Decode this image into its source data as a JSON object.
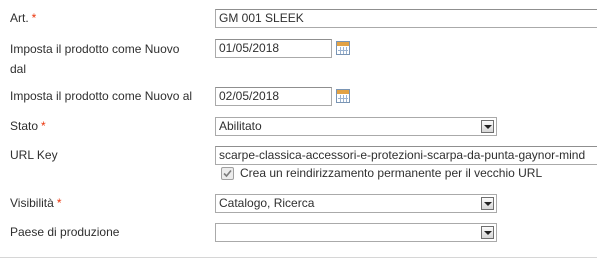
{
  "fields": {
    "art": {
      "label": "Art.",
      "required_mark": "*",
      "value": "GM 001 SLEEK"
    },
    "new_from": {
      "label_line1": "Imposta il prodotto come Nuovo",
      "label_line2": "dal",
      "value": "01/05/2018"
    },
    "new_to": {
      "label": "Imposta il prodotto come Nuovo al",
      "value": "02/05/2018"
    },
    "status": {
      "label": "Stato",
      "required_mark": "*",
      "selected": "Abilitato"
    },
    "url_key": {
      "label": "URL Key",
      "value": "scarpe-classica-accessori-e-protezioni-scarpa-da-punta-gaynor-mind",
      "redirect_label": "Crea un reindirizzamento permanente per il vecchio URL",
      "redirect_checked": true
    },
    "visibility": {
      "label": "Visibilità",
      "required_mark": "*",
      "selected": "Catalogo, Ricerca"
    },
    "country": {
      "label": "Paese di produzione",
      "selected": ""
    }
  },
  "colors": {
    "required": "#eb340a",
    "text": "#2f2f2f",
    "calendar_top": "#e2a245"
  },
  "icons": {
    "calendar": "calendar-icon",
    "select_arrow": "chevron-down-icon",
    "checkmark": "check-icon"
  }
}
